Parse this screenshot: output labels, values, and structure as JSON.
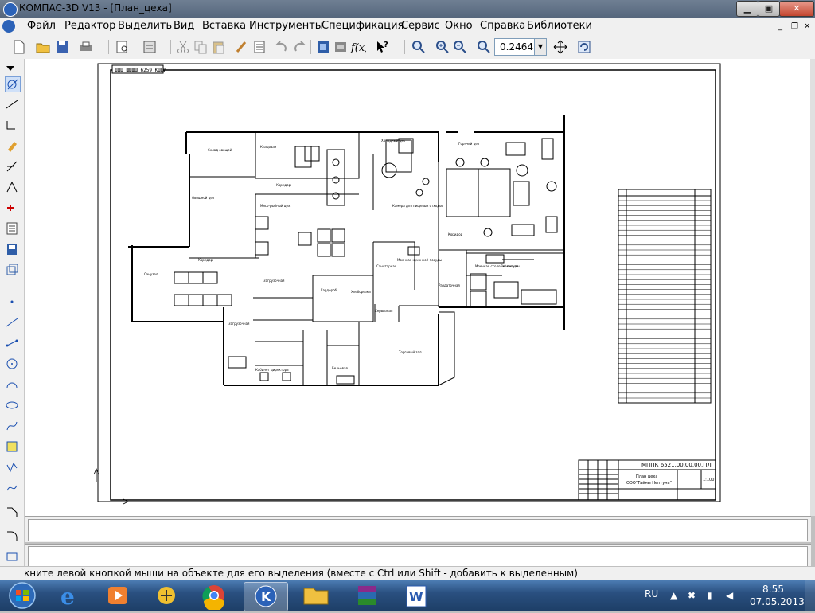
{
  "window": {
    "title": "КОМПАС-3D V13 - [План_цеха]"
  },
  "menu": [
    "Файл",
    "Редактор",
    "Выделить",
    "Вид",
    "Вставка",
    "Инструменты",
    "Спецификация",
    "Сервис",
    "Окно",
    "Справка",
    "Библиотеки"
  ],
  "toolbar": {
    "zoom_value": "0.2464"
  },
  "drawing": {
    "stamp_top": "ШШШ ШШШШ 6259 КШШИ",
    "rooms": [
      "Склад овощей",
      "Кладовая",
      "Мясо-рыбный цех",
      "Овощной цех",
      "Горячий цех",
      "Холодный цех",
      "Коридор",
      "Коридор",
      "Камера для пищевых отходов",
      "Моечная кухонной посуды",
      "Санитарная",
      "Раздаточная",
      "Санузел",
      "Кабинет директора",
      "Загрузочная",
      "Бельевая",
      "Сервизная",
      "Коридор",
      "Гардероб",
      "Моечная столовой посуды",
      "Хлеборезка",
      "Сервизная",
      "Торговый зал",
      "Загрузочная"
    ],
    "title_block": {
      "code": "МППК 6521.00.00.00.ПЛ",
      "name1": "План цеха",
      "name2": "ООО\"Тайны Нептуна\"",
      "sheet": "1:100"
    }
  },
  "status": {
    "hint": "кните левой кнопкой мыши на объекте для его выделения (вместе с Ctrl или Shift - добавить к выделенным)"
  },
  "taskbar": {
    "lang": "RU",
    "time": "8:55",
    "date": "07.05.2013"
  }
}
